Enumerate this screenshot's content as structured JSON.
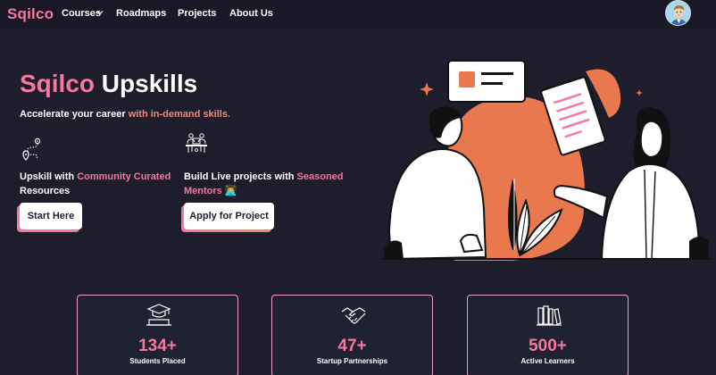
{
  "navbar": {
    "logo": "Sqilco",
    "items": [
      {
        "label": "Courses",
        "has_dropdown": true
      },
      {
        "label": "Roadmaps"
      },
      {
        "label": "Projects"
      },
      {
        "label": "About Us"
      }
    ],
    "avatar_icon": "user-avatar-icon"
  },
  "hero": {
    "title_accent": "Sqilco",
    "title_rest": " Upskills",
    "tagline_plain": "Accelerate your career ",
    "tagline_accent": "with in-demand skills.",
    "features": [
      {
        "icon": "route-map-icon",
        "text_plain": "Upskill with ",
        "text_accent": "Community Curated",
        "text_rest": " Resources",
        "button": "Start Here"
      },
      {
        "icon": "team-collaboration-icon",
        "text_plain": "Build Live projects with ",
        "text_accent": "Seasoned Mentors",
        "text_rest": " 👨‍💻",
        "button": "Apply for Project"
      }
    ]
  },
  "stats": [
    {
      "icon": "graduate-icon",
      "value": "134+",
      "label": "Students Placed"
    },
    {
      "icon": "handshake-icon",
      "value": "47+",
      "label": "Startup Partnerships"
    },
    {
      "icon": "books-icon",
      "value": "500+",
      "label": "Active Learners"
    }
  ],
  "colors": {
    "background": "#1d1d2c",
    "accent_pink": "#f4789f",
    "accent_orange": "#e9784f",
    "text": "#ffffff"
  }
}
